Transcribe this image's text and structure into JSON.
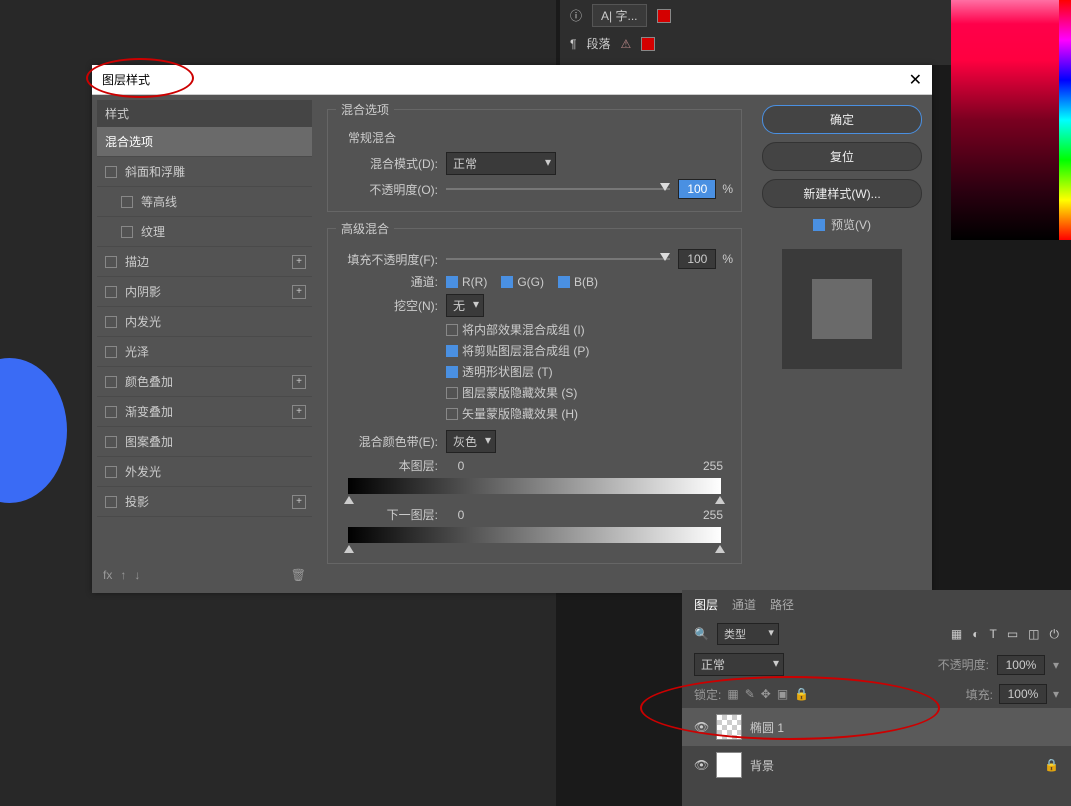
{
  "top": {
    "info_icon": "ⓘ",
    "char_label": "字...",
    "para_label": "段落",
    "warn_icon": "⚠"
  },
  "dialog": {
    "title": "图层样式",
    "close": "✕"
  },
  "styles": {
    "header": "样式",
    "items": [
      {
        "label": "混合选项",
        "selected": true
      },
      {
        "label": "斜面和浮雕",
        "cb": true
      },
      {
        "label": "等高线",
        "cb": true,
        "indent": true
      },
      {
        "label": "纹理",
        "cb": true,
        "indent": true
      },
      {
        "label": "描边",
        "cb": true,
        "plus": true
      },
      {
        "label": "内阴影",
        "cb": true,
        "plus": true
      },
      {
        "label": "内发光",
        "cb": true
      },
      {
        "label": "光泽",
        "cb": true
      },
      {
        "label": "颜色叠加",
        "cb": true,
        "plus": true
      },
      {
        "label": "渐变叠加",
        "cb": true,
        "plus": true
      },
      {
        "label": "图案叠加",
        "cb": true
      },
      {
        "label": "外发光",
        "cb": true
      },
      {
        "label": "投影",
        "cb": true,
        "plus": true
      }
    ],
    "fx_label": "fx",
    "trash_icon": "🗑"
  },
  "blend": {
    "title": "混合选项",
    "general_title": "常规混合",
    "mode_label": "混合模式(D):",
    "mode_value": "正常",
    "opacity_label": "不透明度(O):",
    "opacity_value": "100",
    "pct": "%",
    "adv_title": "高级混合",
    "fill_label": "填充不透明度(F):",
    "fill_value": "100",
    "channel_label": "通道:",
    "ch_r": "R(R)",
    "ch_g": "G(G)",
    "ch_b": "B(B)",
    "knockout_label": "挖空(N):",
    "knockout_value": "无",
    "opt1": "将内部效果混合成组 (I)",
    "opt2": "将剪贴图层混合成组 (P)",
    "opt3": "透明形状图层 (T)",
    "opt4": "图层蒙版隐藏效果 (S)",
    "opt5": "矢量蒙版隐藏效果 (H)",
    "blendif_label": "混合颜色带(E):",
    "blendif_value": "灰色",
    "this_layer": "本图层:",
    "val0": "0",
    "val255": "255",
    "under_layer": "下一图层:"
  },
  "buttons": {
    "ok": "确定",
    "reset": "复位",
    "new_style": "新建样式(W)...",
    "preview_label": "预览(V)"
  },
  "layers": {
    "tab1": "图层",
    "tab2": "通道",
    "tab3": "路径",
    "search_icon": "🔍",
    "filter_value": "类型",
    "mode_value": "正常",
    "opacity_label": "不透明度:",
    "opacity_value": "100%",
    "lock_label": "锁定:",
    "fill_label": "填充:",
    "fill_value": "100%",
    "layer1_name": "椭圆 1",
    "layer2_name": "背景",
    "eye_icon": "👁",
    "lock_icon": "🔒"
  }
}
